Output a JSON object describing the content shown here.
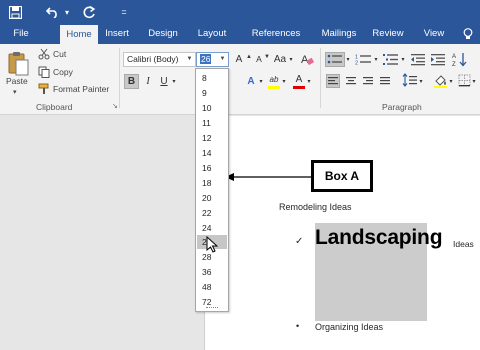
{
  "quick_access": {
    "save_icon": "save-icon",
    "undo_icon": "undo-icon",
    "undo_dropdown": "▾",
    "redo_icon": "redo-icon",
    "customize": "="
  },
  "tabs": [
    {
      "label": "File",
      "active": false
    },
    {
      "label": "Home",
      "active": true
    },
    {
      "label": "Insert",
      "active": false
    },
    {
      "label": "Design",
      "active": false
    },
    {
      "label": "Layout",
      "active": false
    },
    {
      "label": "References",
      "active": false
    },
    {
      "label": "Mailings",
      "active": false
    },
    {
      "label": "Review",
      "active": false
    },
    {
      "label": "View",
      "active": false
    }
  ],
  "tell_me_icon": "lightbulb-icon",
  "clipboard": {
    "paste_label": "Paste",
    "cut_label": "Cut",
    "copy_label": "Copy",
    "format_painter_label": "Format Painter",
    "group_name": "Clipboard"
  },
  "font": {
    "font_name": "Calibri (Body)",
    "font_size": "26",
    "grow": "A",
    "shrink": "A",
    "change_case": "Aa",
    "bold": "B",
    "italic": "I",
    "underline": "U",
    "text_effects": "A",
    "highlight": "ab",
    "font_color": "A"
  },
  "paragraph": {
    "group_name": "Paragraph"
  },
  "font_sizes": [
    "8",
    "9",
    "10",
    "11",
    "12",
    "14",
    "16",
    "18",
    "20",
    "22",
    "24",
    "26",
    "28",
    "36",
    "48",
    "72"
  ],
  "highlighted_size": "26",
  "callout": {
    "label": "Box A"
  },
  "document": {
    "heading": "Remodeling Ideas",
    "check_mark": "✓",
    "big_word": "Landscaping",
    "trailing_word": "Ideas",
    "bullet": "•",
    "bullet_item": "Organizing Ideas"
  },
  "colors": {
    "brand_blue": "#2b579a",
    "ribbon_bg": "#f3f3f3",
    "highlight_gray": "#cccccc",
    "font_color_red": "#e00000",
    "highlighter_yellow": "#ffff00"
  }
}
